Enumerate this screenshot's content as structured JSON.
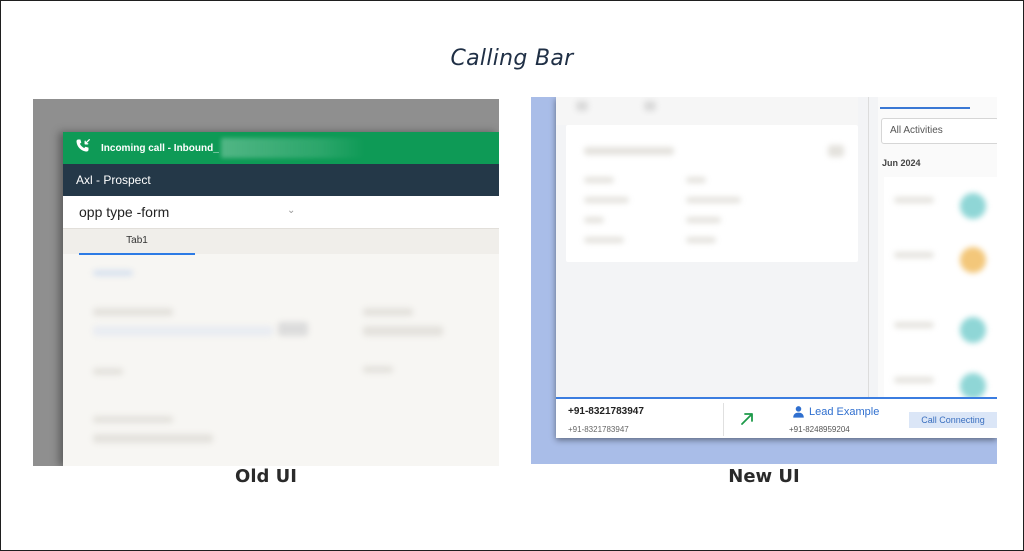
{
  "page": {
    "title": "Calling Bar"
  },
  "captions": {
    "old": "Old UI",
    "new": "New UI"
  },
  "old_ui": {
    "call_bar": {
      "text": "Incoming call - Inbound_",
      "color": "#0e9a56",
      "icon": "phone-incoming-icon"
    },
    "header": {
      "title": "Axl - Prospect",
      "color": "#243848"
    },
    "form": {
      "title": "opp type -form"
    },
    "tabs": [
      {
        "label": "Tab1"
      }
    ]
  },
  "new_ui": {
    "activities": {
      "filter_value": "All Activities",
      "month_label": "Jun 2024"
    },
    "call_bar": {
      "caller_number": "+91-8321783947",
      "caller_subnumber": "+91-8321783947",
      "direction_icon": "outgoing-arrow-icon",
      "contact_name": "Lead Example",
      "contact_icon": "person-icon",
      "contact_number": "+91-8248959204",
      "status": "Call Connecting",
      "accent_color": "#3b7de0"
    }
  }
}
